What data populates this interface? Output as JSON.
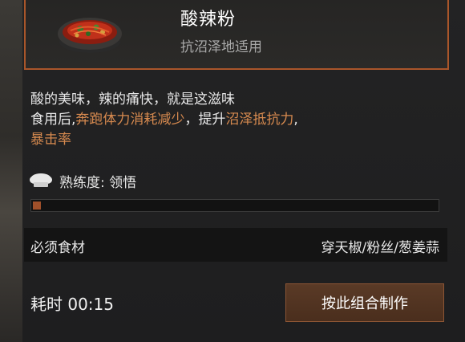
{
  "item": {
    "name": "酸辣粉",
    "subtitle": "抗沼泽地适用"
  },
  "description": {
    "line1": "酸的美味，辣的痛快，就是这滋味",
    "line2_prefix": "食用后,",
    "line2_hl1": "奔跑体力消耗减少",
    "line2_mid": "，提升",
    "line2_hl2": "沼泽抵抗力",
    "line2_sep": ",",
    "line3_hl3": "暴击率"
  },
  "proficiency": {
    "label": "熟练度: 领悟",
    "progress_fraction": 0.02
  },
  "ingredients": {
    "label": "必须食材",
    "value": "穿天椒/粉丝/葱姜蒜"
  },
  "time_label": "耗时 00:15",
  "craft_button": "按此组合制作",
  "colors": {
    "accent_border": "#a9562a",
    "highlight_text": "#d78a4f",
    "button_bg": "#5a3a26"
  },
  "icons": {
    "dish": "noodle-bowl-icon",
    "chef": "chef-hat-icon"
  }
}
